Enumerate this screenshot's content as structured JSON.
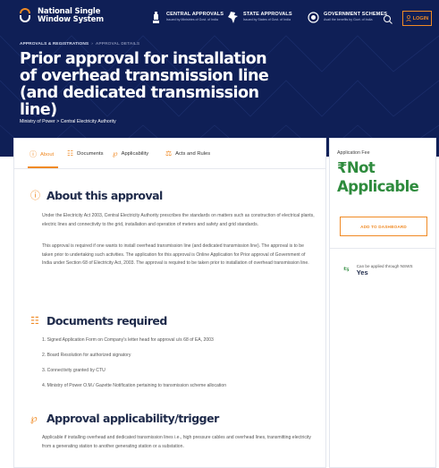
{
  "header": {
    "logo_line1": "National Single",
    "logo_line2": "Window System",
    "nav": [
      {
        "title": "CENTRAL APPROVALS",
        "subtitle": "Issued by Ministries of Govt. of India",
        "icon": "emblem-icon"
      },
      {
        "title": "STATE APPROVALS",
        "subtitle": "Issued by States of Govt. of India",
        "icon": "india-map-icon"
      },
      {
        "title": "GOVERNMENT SCHEMES",
        "subtitle": "Avail the benefits by Govt. of India",
        "icon": "scheme-icon"
      }
    ],
    "login_label": "LOGIN"
  },
  "breadcrumb": {
    "first": "APPROVALS & REGISTRATIONS",
    "current": "APPROVAL DETAILS"
  },
  "page": {
    "title": "Prior approval for installation of overhead transmission line (and dedicated transmission line)",
    "ministry": "Ministry of Power > Central Electricity Authority"
  },
  "tabs": [
    {
      "label": "About",
      "icon": "info-icon"
    },
    {
      "label": "Documents",
      "icon": "document-icon"
    },
    {
      "label": "Applicability",
      "icon": "applicability-icon"
    },
    {
      "label": "Acts and Rules",
      "icon": "gavel-icon"
    }
  ],
  "about": {
    "heading": "About this approval",
    "para1": "Under the Electricity Act 2003, Central Electricity Authority prescribes the standards on matters such as construction of electrical plants, electric lines and connectivity to the grid, installation and operation of meters and safety and grid standards.",
    "para2": "This approval is required if one wants to install overhead transmission line (and dedicated transmission line). The approval is to be taken prior to undertaking such activities. The application for this approval is Online Application for Prior approval of Government of India under Section 68 of Electricity Act, 2003. The approval is required to be taken prior to installation of overhead transmission line."
  },
  "documents": {
    "heading": "Documents required",
    "items": [
      "1. Signed Application Form on Company's letter head for approval u/s 68 of EA, 2003",
      "2. Board Resolution for authorized signatory",
      "3. Connectivity granted by CTU",
      "4. Ministry of Power O.M./ Gazette Notification pertaining to transmission scheme allocation"
    ]
  },
  "applicability": {
    "heading": "Approval applicability/trigger",
    "para": "Applicable if installing overhead and dedicated transmission lines i.e., high pressure cables and overhead lines, transmitting electricity from a generating station to another generating station or a substation."
  },
  "side": {
    "fee_label": "Application Fee",
    "fee_value": "₹Not Applicable",
    "dashboard_button": "ADD TO DASHBOARD",
    "nsws_label": "Can be applied through NSWS",
    "nsws_value": "Yes"
  },
  "colors": {
    "header_bg": "#0f1f56",
    "accent": "#f08a24",
    "fee_green": "#2e8b3d"
  }
}
